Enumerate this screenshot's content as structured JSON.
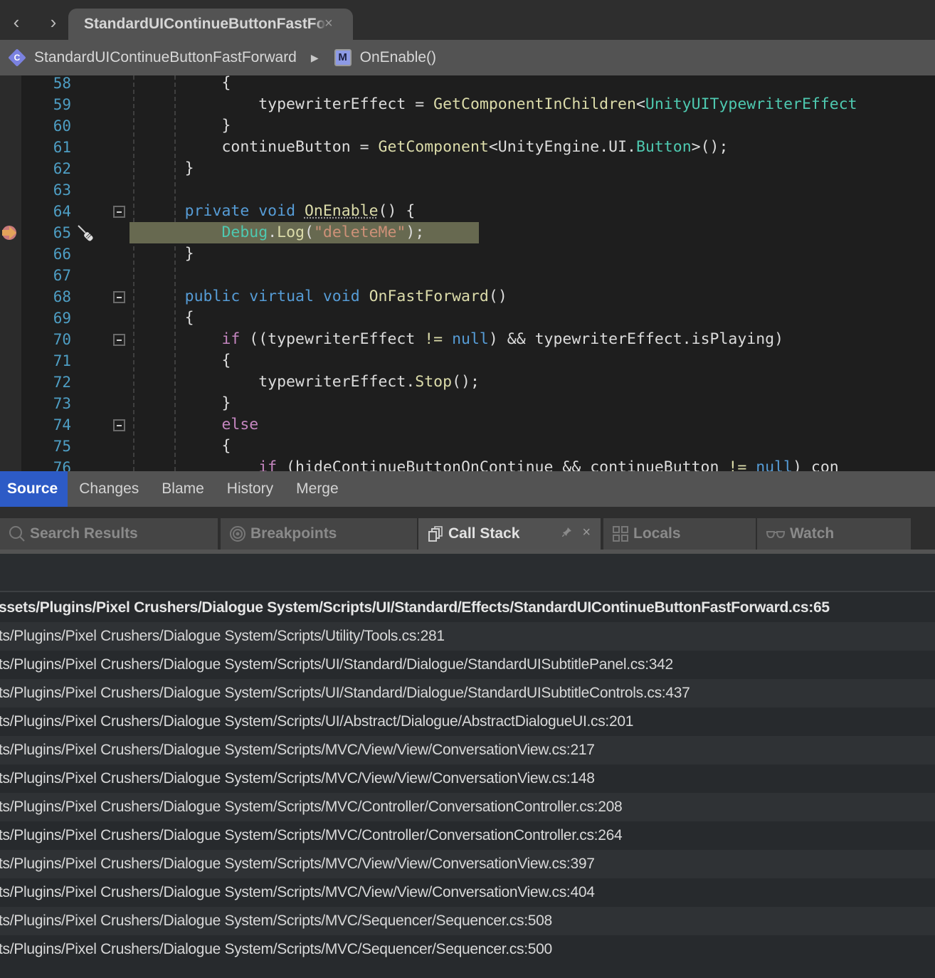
{
  "tabstrip": {
    "back_glyph": "‹",
    "forward_glyph": "›",
    "active_tab": {
      "label": "StandardUIContinueButtonFastForward",
      "close_glyph": "×"
    }
  },
  "breadcrumb": {
    "class_icon_letter": "C",
    "class_name": "StandardUIContinueButtonFastForward",
    "separator_glyph": "▶",
    "method_icon_letter": "M",
    "method_name": "OnEnable()"
  },
  "editor": {
    "current_line": 65,
    "lines": [
      {
        "n": "58",
        "fold": false
      },
      {
        "n": "59",
        "fold": false
      },
      {
        "n": "60",
        "fold": false
      },
      {
        "n": "61",
        "fold": false
      },
      {
        "n": "62",
        "fold": false
      },
      {
        "n": "63",
        "fold": false
      },
      {
        "n": "64",
        "fold": true
      },
      {
        "n": "65",
        "fold": false
      },
      {
        "n": "66",
        "fold": false
      },
      {
        "n": "67",
        "fold": false
      },
      {
        "n": "68",
        "fold": true
      },
      {
        "n": "69",
        "fold": false
      },
      {
        "n": "70",
        "fold": true
      },
      {
        "n": "71",
        "fold": false
      },
      {
        "n": "72",
        "fold": false
      },
      {
        "n": "73",
        "fold": false
      },
      {
        "n": "74",
        "fold": true
      },
      {
        "n": "75",
        "fold": false
      },
      {
        "n": "76",
        "fold": false
      }
    ],
    "code": {
      "l58": {
        "indent": "          ",
        "brace": "{"
      },
      "l59": {
        "indent": "              ",
        "var": "typewriterEffect",
        "eq": " = ",
        "fn": "GetComponentInChildren",
        "lt": "<",
        "type": "UnityUITypewriterEffect"
      },
      "l60": {
        "indent": "          ",
        "brace": "}"
      },
      "l61": {
        "indent": "          ",
        "var": "continueButton",
        "eq": " = ",
        "fn": "GetComponent",
        "ns": "<UnityEngine.UI.",
        "type": "Button",
        "tail": ">();"
      },
      "l62": {
        "indent": "      ",
        "brace": "}"
      },
      "l64": {
        "indent": "      ",
        "kw1": "private",
        "kw2": "void",
        "fn": "OnEnable",
        "tail": "() {"
      },
      "l65": {
        "indent": "          ",
        "type": "Debug",
        "dot": ".",
        "fn": "Log",
        "open": "(",
        "str": "\"deleteMe\"",
        "tail": ");"
      },
      "l66": {
        "indent": "      ",
        "brace": "}"
      },
      "l68": {
        "indent": "      ",
        "kw1": "public",
        "kw2": "virtual",
        "kw3": "void",
        "fn": "OnFastForward",
        "tail": "()"
      },
      "l69": {
        "indent": "      ",
        "brace": "{"
      },
      "l70": {
        "indent": "          ",
        "kw": "if",
        "a": " ((typewriterEffect ",
        "op": "!=",
        "sp": " ",
        "null": "null",
        "b": ") && typewriterEffect.isPlaying)"
      },
      "l71": {
        "indent": "          ",
        "brace": "{"
      },
      "l72": {
        "indent": "              ",
        "a": "typewriterEffect.",
        "fn": "Stop",
        "tail": "();"
      },
      "l73": {
        "indent": "          ",
        "brace": "}"
      },
      "l74": {
        "indent": "          ",
        "kw": "else"
      },
      "l75": {
        "indent": "          ",
        "brace": "{"
      },
      "l76": {
        "indent": "              ",
        "kw": "if",
        "a": " (hideContinueButtonOnContinue && continueButton ",
        "op": "!=",
        "sp": " ",
        "null": "null",
        "b": ") con"
      }
    }
  },
  "vcs_tabs": [
    {
      "label": "Source",
      "active": true
    },
    {
      "label": "Changes",
      "active": false
    },
    {
      "label": "Blame",
      "active": false
    },
    {
      "label": "History",
      "active": false
    },
    {
      "label": "Merge",
      "active": false
    }
  ],
  "pad_tabs": [
    {
      "label": "Search Results",
      "icon": "search-icon",
      "active": false
    },
    {
      "label": "Breakpoints",
      "icon": "breakpoints-icon",
      "active": false
    },
    {
      "label": "Call Stack",
      "icon": "call-stack-icon",
      "active": true,
      "pin_glyph": "📌",
      "close_glyph": "×"
    },
    {
      "label": "Locals",
      "icon": "locals-icon",
      "active": false
    },
    {
      "label": "Watch",
      "icon": "watch-icon",
      "active": false
    }
  ],
  "call_stack": {
    "frames": [
      "ssets/Plugins/Pixel Crushers/Dialogue System/Scripts/UI/Standard/Effects/StandardUIContinueButtonFastForward.cs:65",
      "ts/Plugins/Pixel Crushers/Dialogue System/Scripts/Utility/Tools.cs:281",
      "ts/Plugins/Pixel Crushers/Dialogue System/Scripts/UI/Standard/Dialogue/StandardUISubtitlePanel.cs:342",
      "ts/Plugins/Pixel Crushers/Dialogue System/Scripts/UI/Standard/Dialogue/StandardUISubtitleControls.cs:437",
      "ts/Plugins/Pixel Crushers/Dialogue System/Scripts/UI/Abstract/Dialogue/AbstractDialogueUI.cs:201",
      "ts/Plugins/Pixel Crushers/Dialogue System/Scripts/MVC/View/View/ConversationView.cs:217",
      "ts/Plugins/Pixel Crushers/Dialogue System/Scripts/MVC/View/View/ConversationView.cs:148",
      "ts/Plugins/Pixel Crushers/Dialogue System/Scripts/MVC/Controller/ConversationController.cs:208",
      "ts/Plugins/Pixel Crushers/Dialogue System/Scripts/MVC/Controller/ConversationController.cs:264",
      "ts/Plugins/Pixel Crushers/Dialogue System/Scripts/MVC/View/View/ConversationView.cs:397",
      "ts/Plugins/Pixel Crushers/Dialogue System/Scripts/MVC/View/View/ConversationView.cs:404",
      "ts/Plugins/Pixel Crushers/Dialogue System/Scripts/MVC/Sequencer/Sequencer.cs:508",
      "ts/Plugins/Pixel Crushers/Dialogue System/Scripts/MVC/Sequencer/Sequencer.cs:500"
    ]
  }
}
